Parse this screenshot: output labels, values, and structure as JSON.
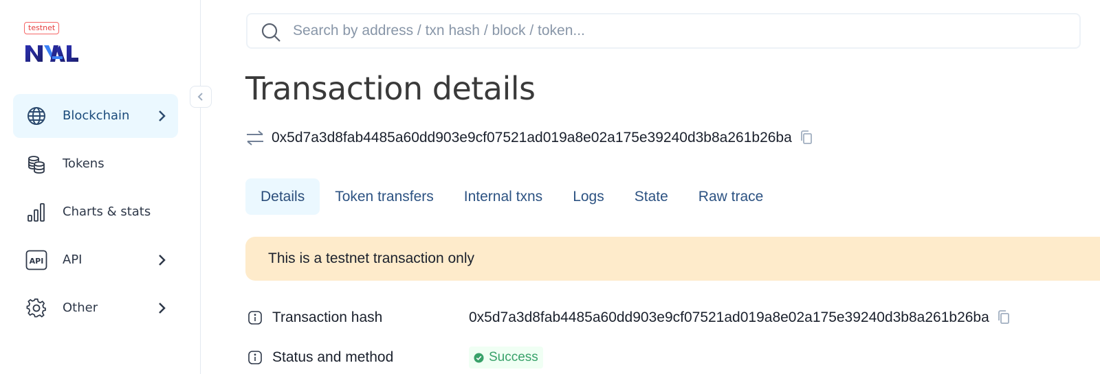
{
  "sidebar": {
    "network_badge": "testnet",
    "logo_icon": "nal-logo",
    "collapse_icon": "chevron-left-icon",
    "items": [
      {
        "label": "Blockchain",
        "icon": "globe-icon",
        "has_submenu": true,
        "active": true
      },
      {
        "label": "Tokens",
        "icon": "coins-icon",
        "has_submenu": false,
        "active": false
      },
      {
        "label": "Charts & stats",
        "icon": "bar-chart-icon",
        "has_submenu": false,
        "active": false
      },
      {
        "label": "API",
        "icon": "api-icon",
        "has_submenu": true,
        "active": false
      },
      {
        "label": "Other",
        "icon": "gear-icon",
        "has_submenu": true,
        "active": false
      }
    ]
  },
  "search": {
    "placeholder": "Search by address / txn hash / block / token...",
    "icon": "search-icon"
  },
  "page": {
    "title": "Transaction details",
    "hash": "0x5d7a3d8fab4485a60dd903e9cf07521ad019a8e02a175e39240d3b8a261b26ba"
  },
  "tabs": [
    {
      "label": "Details",
      "active": true
    },
    {
      "label": "Token transfers",
      "active": false
    },
    {
      "label": "Internal txns",
      "active": false
    },
    {
      "label": "Logs",
      "active": false
    },
    {
      "label": "State",
      "active": false
    },
    {
      "label": "Raw trace",
      "active": false
    }
  ],
  "alert": {
    "text": "This is a testnet transaction only"
  },
  "details": {
    "transaction_hash": {
      "label": "Transaction hash",
      "value": "0x5d7a3d8fab4485a60dd903e9cf07521ad019a8e02a175e39240d3b8a261b26ba"
    },
    "status": {
      "label": "Status and method",
      "value": "Success"
    }
  },
  "colors": {
    "accent": "#2c5282",
    "active_bg": "#ebf8ff",
    "alert_bg": "#feebcb",
    "success": "#38a169",
    "badge_red": "#e53e3e"
  }
}
